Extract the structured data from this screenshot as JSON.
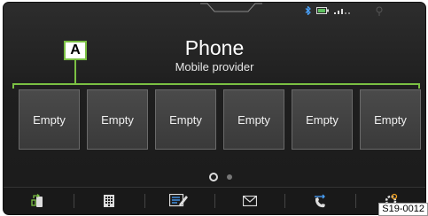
{
  "header": {
    "title": "Phone",
    "subtitle": "Mobile provider"
  },
  "callout": {
    "label": "A"
  },
  "favorites": {
    "slots": [
      {
        "label": "Empty"
      },
      {
        "label": "Empty"
      },
      {
        "label": "Empty"
      },
      {
        "label": "Empty"
      },
      {
        "label": "Empty"
      },
      {
        "label": "Empty"
      }
    ]
  },
  "pagination": {
    "current_page": 1,
    "total_pages": 2
  },
  "nav": {
    "items": [
      {
        "icon": "phone-transfer-icon"
      },
      {
        "icon": "keypad-icon"
      },
      {
        "icon": "contacts-icon"
      },
      {
        "icon": "message-icon"
      },
      {
        "icon": "call-list-icon"
      },
      {
        "icon": "settings-icon"
      }
    ]
  },
  "figure_code": "S19-0012",
  "colors": {
    "accent": "#7bc043",
    "bluetooth": "#4aa3ff",
    "battery": "#5fc060"
  }
}
